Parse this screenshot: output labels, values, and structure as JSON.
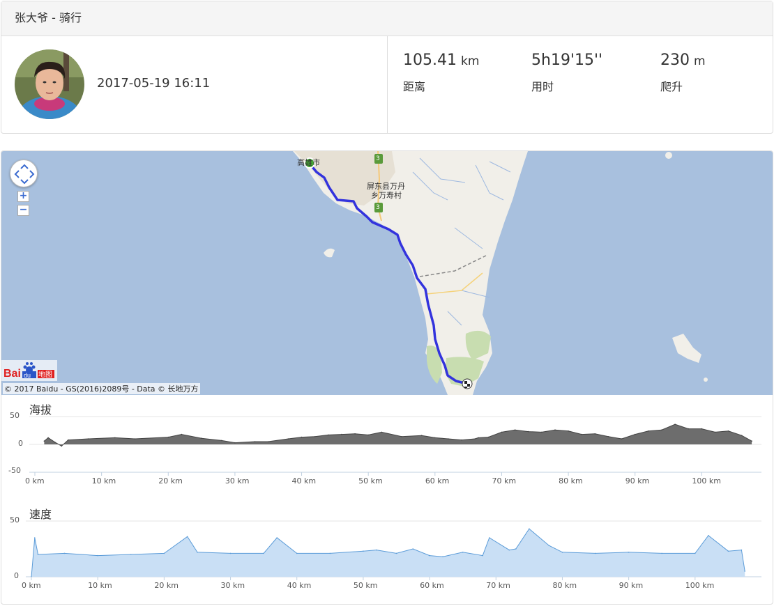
{
  "header": {
    "title": "张大爷 - 骑行"
  },
  "profile": {
    "datetime": "2017-05-19 16:11"
  },
  "stats": [
    {
      "value": "105.41",
      "unit": "km",
      "label": "距离"
    },
    {
      "value": "5h19'15''",
      "unit": "",
      "label": "用时"
    },
    {
      "value": "230",
      "unit": "m",
      "label": "爬升"
    }
  ],
  "map": {
    "copyright": "© 2017 Baidu - GS(2016)2089号 - Data © 长地万方",
    "city_label": "高雄市",
    "place_label_1": "屏东县万丹",
    "place_label_2": "乡万寿村",
    "road_shield": "3",
    "zoom_in": "+",
    "zoom_out": "−",
    "logo_text": "Baidu地图",
    "colors": {
      "sea": "#a8c0de",
      "land": "#f1efe9",
      "route": "#3333dd",
      "start": "#44aa33"
    }
  },
  "elevation_chart": {
    "title": "海拔",
    "yticks": [
      "50",
      "0",
      "-50"
    ],
    "xticks": [
      "0 km",
      "10 km",
      "20 km",
      "30 km",
      "40 km",
      "50 km",
      "60 km",
      "70 km",
      "80 km",
      "90 km",
      "100 km"
    ]
  },
  "speed_chart": {
    "title": "速度",
    "yticks": [
      "50",
      "0"
    ],
    "xticks": [
      "0 km",
      "10 km",
      "20 km",
      "30 km",
      "40 km",
      "50 km",
      "60 km",
      "70 km",
      "80 km",
      "90 km",
      "100 km"
    ]
  },
  "chart_data": [
    {
      "type": "area",
      "title": "海拔",
      "xlabel": "",
      "ylabel": "",
      "xlim": [
        0,
        110
      ],
      "ylim": [
        -50,
        50
      ],
      "x": [
        1.4,
        2,
        3,
        4,
        5,
        8,
        12,
        15,
        20,
        22,
        25,
        28,
        30,
        33,
        35,
        38,
        40,
        42,
        44,
        46,
        48,
        50,
        52,
        55,
        58,
        60,
        62,
        64,
        66,
        66.5,
        68,
        70,
        72,
        74,
        76,
        78,
        80,
        82,
        84,
        86,
        88,
        90,
        92,
        94,
        96,
        98,
        100,
        102,
        104,
        106,
        107.5
      ],
      "y": [
        6,
        12,
        4,
        -3,
        8,
        10,
        12,
        10,
        13,
        18,
        11,
        7,
        3,
        5,
        5,
        10,
        13,
        14,
        17,
        18,
        19,
        17,
        22,
        14,
        16,
        12,
        10,
        8,
        10,
        12,
        13,
        22,
        26,
        23,
        22,
        26,
        24,
        18,
        19,
        14,
        10,
        18,
        24,
        26,
        36,
        28,
        28,
        22,
        24,
        16,
        6
      ]
    },
    {
      "type": "area",
      "title": "速度",
      "xlabel": "",
      "ylabel": "",
      "xlim": [
        0,
        110
      ],
      "ylim": [
        0,
        50
      ],
      "x": [
        0,
        0.5,
        1,
        5,
        10,
        15,
        20,
        23.5,
        25,
        30,
        35,
        37,
        40,
        45,
        50,
        52,
        55,
        57.5,
        60,
        62,
        65,
        68,
        69,
        72,
        73,
        75,
        78,
        80,
        85,
        90,
        95,
        100,
        102,
        105,
        107,
        107.5
      ],
      "y": [
        0,
        35,
        20,
        21,
        19,
        20,
        21,
        36,
        22,
        21,
        21,
        35,
        21,
        21,
        23,
        24,
        21,
        25,
        19,
        18,
        22,
        19,
        35,
        24,
        25,
        43,
        28,
        22,
        21,
        22,
        21,
        21,
        37,
        23,
        24,
        5
      ]
    }
  ]
}
